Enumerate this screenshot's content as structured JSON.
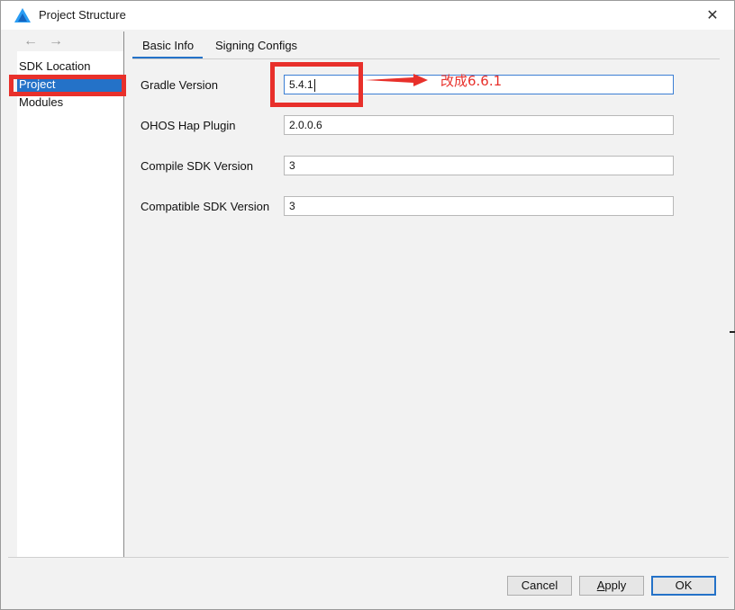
{
  "window": {
    "title": "Project Structure",
    "close_glyph": "✕",
    "app_icon": "harmony-devtools-logo"
  },
  "nav": {
    "back_glyph": "←",
    "forward_glyph": "→",
    "items": [
      {
        "label": "SDK Location",
        "selected": false
      },
      {
        "label": "Project",
        "selected": true
      },
      {
        "label": "Modules",
        "selected": false
      }
    ]
  },
  "tabs": [
    {
      "label": "Basic Info",
      "active": true
    },
    {
      "label": "Signing Configs",
      "active": false
    }
  ],
  "form": {
    "fields": [
      {
        "label": "Gradle Version",
        "value": "5.4.1",
        "focused": true
      },
      {
        "label": "OHOS Hap Plugin",
        "value": "2.0.0.6",
        "focused": false
      },
      {
        "label": "Compile SDK Version",
        "value": "3",
        "focused": false
      },
      {
        "label": "Compatible SDK Version",
        "value": "3",
        "focused": false
      }
    ]
  },
  "annotation": {
    "text": "改成6.6.1",
    "color": "#e8302b"
  },
  "buttons": {
    "cancel": "Cancel",
    "apply_mnemonic": "A",
    "apply_rest": "pply",
    "ok": "OK"
  },
  "colors": {
    "accent": "#2472c8",
    "annotation_red": "#e8302b"
  }
}
